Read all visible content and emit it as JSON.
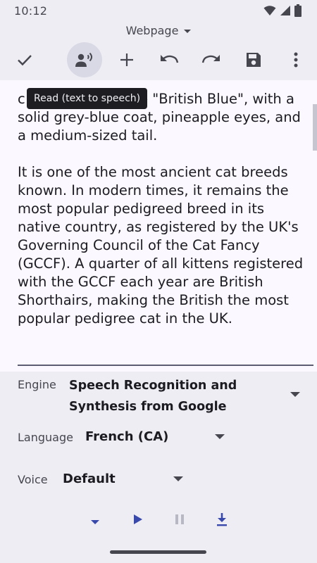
{
  "status": {
    "time": "10:12"
  },
  "header": {
    "title": "Webpage"
  },
  "toolbar": {
    "items": [
      {
        "name": "check-icon",
        "label": "Done"
      },
      {
        "name": "speaker-icon",
        "label": "Read (text to speech)",
        "active": true
      },
      {
        "name": "plus-icon",
        "label": "Add"
      },
      {
        "name": "undo-icon",
        "label": "Undo"
      },
      {
        "name": "redo-icon",
        "label": "Redo"
      },
      {
        "name": "save-icon",
        "label": "Save"
      },
      {
        "name": "more-vert-icon",
        "label": "More options"
      }
    ]
  },
  "tooltip": {
    "text": "Read (text to speech)"
  },
  "article": {
    "paragraph1": "c               he \"British Blue\", with a solid grey-blue coat, pineapple eyes, and a medium-sized tail.",
    "paragraph1_visible_start": "c",
    "paragraph1_visible_end": "he \"British Blue\", with a",
    "paragraph1_rest": "solid grey-blue coat, pineapple eyes, and a medium-sized tail.",
    "paragraph2": "It is one of the most ancient cat breeds known. In modern times, it remains the most popular pedigreed breed in its native country, as registered by the UK's Governing Council of the Cat Fancy (GCCF). A quarter of all kittens registered with the GCCF each year are British Shorthairs, making the British the most popular pedigree cat in the UK."
  },
  "tts": {
    "engine_label": "Engine",
    "engine_value_line1": "Speech Recognition and",
    "engine_value_line2": "Synthesis from Google",
    "language_label": "Language",
    "language_value": "French (CA)",
    "voice_label": "Voice",
    "voice_value": "Default"
  },
  "controls": {
    "accent": "#3949ab",
    "disabled": "#b8b8c4"
  }
}
